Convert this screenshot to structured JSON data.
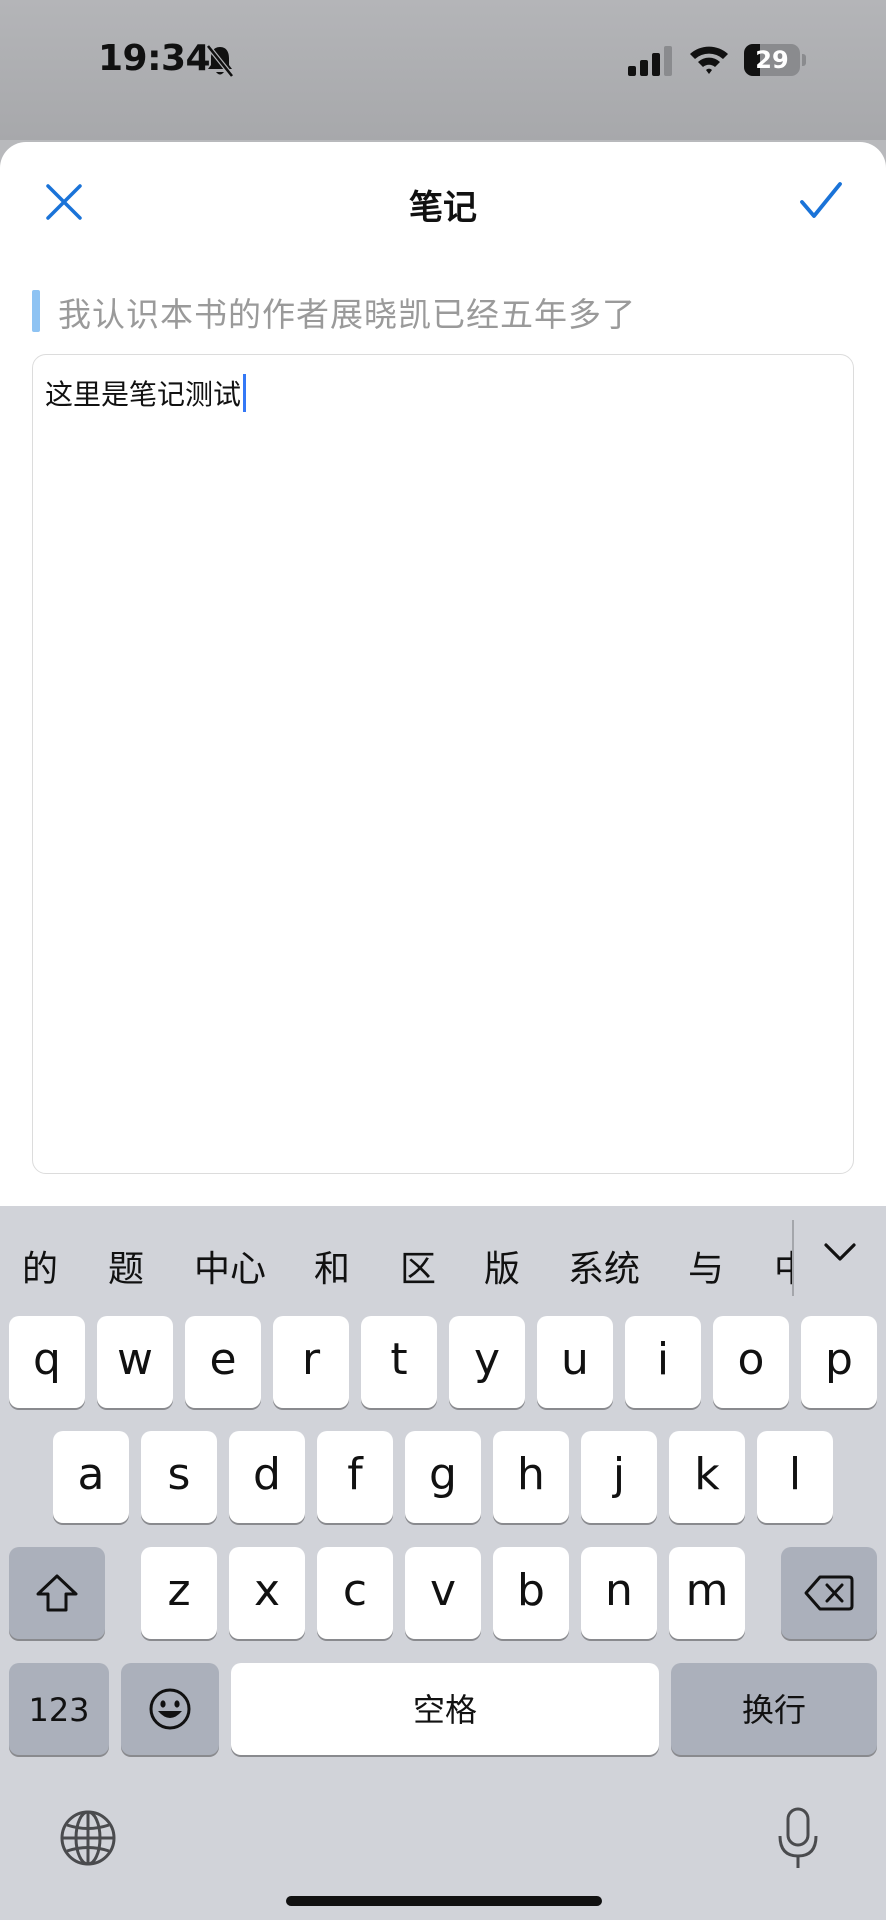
{
  "status_bar": {
    "time": "19:34",
    "battery": "29",
    "battery_level": 0.29
  },
  "sheet": {
    "title": "笔记",
    "quote": "我认识本书的作者展晓凯已经五年多了",
    "note": "这里是笔记测试"
  },
  "keyboard": {
    "candidates": [
      "的",
      "题",
      "中心",
      "和",
      "区",
      "版",
      "系统",
      "与",
      "中"
    ],
    "row1": [
      "q",
      "w",
      "e",
      "r",
      "t",
      "y",
      "u",
      "i",
      "o",
      "p"
    ],
    "row2": [
      "a",
      "s",
      "d",
      "f",
      "g",
      "h",
      "j",
      "k",
      "l"
    ],
    "row3": [
      "z",
      "x",
      "c",
      "v",
      "b",
      "n",
      "m"
    ],
    "numbers_label": "123",
    "space_label": "空格",
    "return_label": "换行"
  },
  "colors": {
    "accent": "#1a73d8",
    "quote_bar": "#8ec3f3",
    "caret": "#3478f6"
  }
}
